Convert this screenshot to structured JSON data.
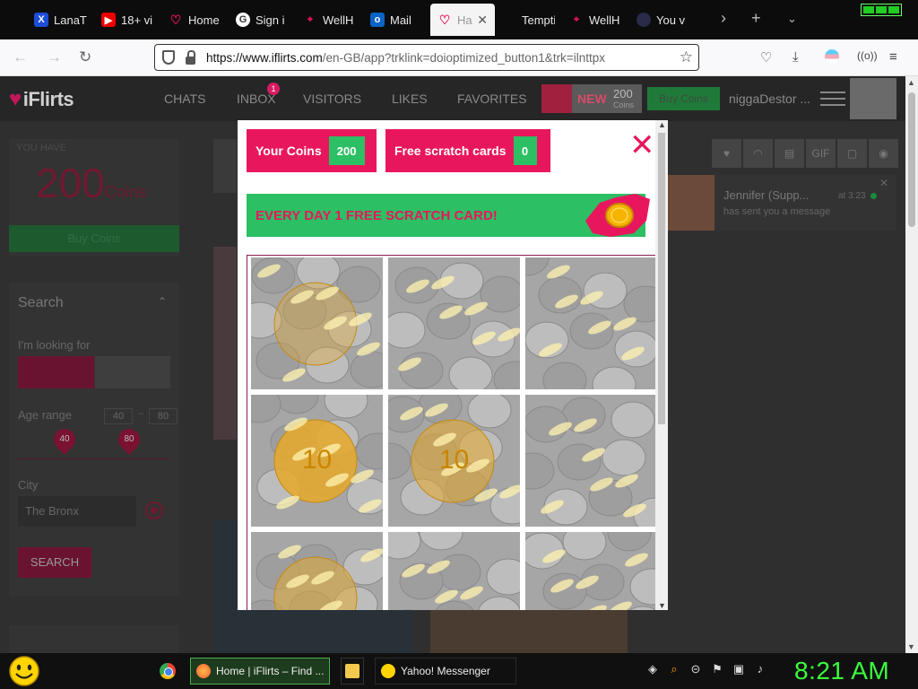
{
  "browser": {
    "tabs": [
      {
        "label": "LanaT",
        "icon": "x-icon",
        "color": "#1d4ed8"
      },
      {
        "label": "18+ vi",
        "icon": "youtube-icon",
        "color": "#e00"
      },
      {
        "label": "Home",
        "icon": "heart-icon",
        "color": "#c2185b"
      },
      {
        "label": "Sign i",
        "icon": "google-icon",
        "color": "#ffffff"
      },
      {
        "label": "WellH",
        "icon": "pin-icon",
        "color": "#c2185b"
      },
      {
        "label": "Mail",
        "icon": "outlook-icon",
        "color": "#0a64c8"
      },
      {
        "label": "Ha",
        "icon": "heart-icon",
        "color": "#e8175d",
        "active": true
      },
      {
        "label": "Tempting",
        "icon": "blank-icon",
        "color": "#0c0c0c"
      },
      {
        "label": "WellH",
        "icon": "pin-icon",
        "color": "#c2185b"
      },
      {
        "label": "You v",
        "icon": "dark-circle-icon",
        "color": "#2a2a4a"
      }
    ],
    "url_domain": "https://www.iflirts.com",
    "url_path": "/en-GB/app?trklink=doioptimized_button1&trk=ilnttpx"
  },
  "site": {
    "logo": "iFlirts",
    "nav": [
      "CHATS",
      "INBOX",
      "VISITORS",
      "LIKES",
      "FAVORITES"
    ],
    "inbox_badge": "1",
    "new_label": "NEW",
    "new_coins": "200",
    "new_coins_label": "Coins",
    "buy_coins": "Buy Coins",
    "username": "niggaDestor ..."
  },
  "left": {
    "you_have": "YOU HAVE",
    "coins_num": "200",
    "coins_word": "Coins",
    "buy_coins": "Buy Coins",
    "search_title": "Search",
    "looking_for": "I'm looking for",
    "age_range": "Age range",
    "age_min": "40",
    "age_max": "80",
    "city_label": "City",
    "city_value": "The Bronx",
    "search_btn": "SEARCH"
  },
  "right": {
    "icons": [
      "heart-icon",
      "lips-icon",
      "gift-icon",
      "GIF",
      "chat-icon",
      "eye-icon"
    ],
    "notif_name": "Jennifer (Supp...",
    "notif_time": "at 3:23",
    "notif_msg": "has sent you a message"
  },
  "modal": {
    "your_coins_label": "Your Coins",
    "your_coins_value": "200",
    "scratch_label": "Free scratch cards",
    "scratch_value": "0",
    "banner": "EVERY DAY 1 FREE SCRATCH CARD!",
    "cells": [
      {
        "coin": "",
        "gold": 0.35
      },
      {
        "coin": "",
        "gold": 0.3
      },
      {
        "coin": "",
        "gold": 0.25
      },
      {
        "coin": "10",
        "gold": 0.85
      },
      {
        "coin": "10",
        "gold": 0.55
      },
      {
        "coin": "",
        "gold": 0.15
      },
      {
        "coin": "",
        "gold": 0.5
      },
      {
        "coin": "",
        "gold": 0.1
      },
      {
        "coin": "",
        "gold": 0.2
      }
    ],
    "accent": "#e8175d",
    "green": "#2dbf64"
  },
  "taskbar": {
    "task1": "Home | iFlirts – Find ...",
    "task2": "Yahoo! Messenger",
    "clock": "8:21 AM"
  }
}
